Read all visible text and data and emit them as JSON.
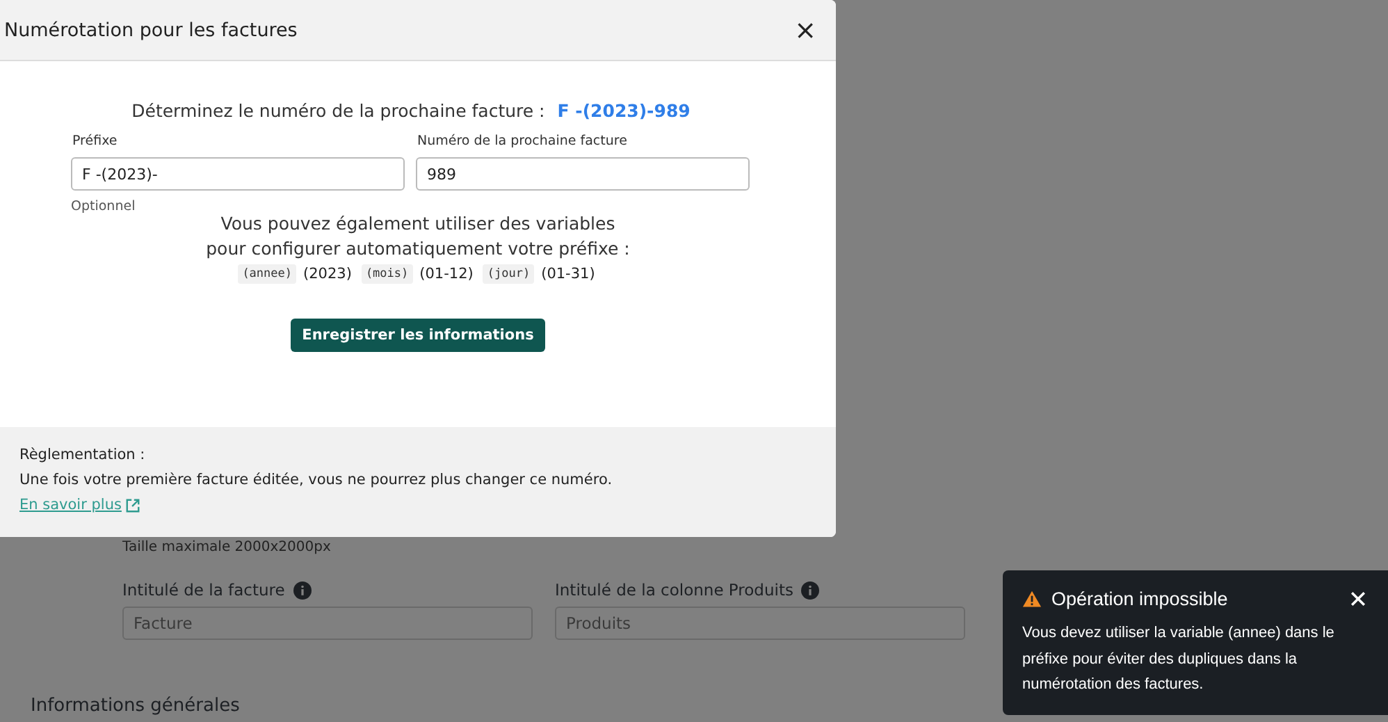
{
  "background": {
    "size_hint": "Taille maximale 2000x2000px",
    "fields": [
      {
        "label": "Intitulé de la facture",
        "placeholder": "Facture"
      },
      {
        "label": "Intitulé de la colonne Produits",
        "placeholder": "Produits"
      }
    ],
    "section_title": "Informations générales"
  },
  "modal": {
    "title": "Numérotation pour les factures",
    "close": "×",
    "heading": "Déterminez le numéro de la prochaine facture :",
    "preview": "F -(2023)-989",
    "fields": [
      {
        "label": "Préfixe",
        "value": "F -(2023)-",
        "help": "Optionnel"
      },
      {
        "label": "Numéro de la prochaine facture",
        "value": "989"
      }
    ],
    "variables_text": [
      "Vous pouvez également utiliser des variables",
      "pour configurer automatiquement votre préfixe :"
    ],
    "variables": [
      {
        "code": "(annee)",
        "range": "(2023)"
      },
      {
        "code": "(mois)",
        "range": "(01-12)"
      },
      {
        "code": "(jour)",
        "range": "(01-31)"
      }
    ],
    "save_button": "Enregistrer les informations",
    "footer": {
      "title": "Règlementation :",
      "text": "Une fois votre première facture éditée, vous ne pourrez plus changer ce numéro.",
      "link": "En savoir plus"
    }
  },
  "toast": {
    "title": "Opération impossible",
    "message": "Vous devez utiliser la variable (annee) dans le préfixe pour éviter des dupliques dans la numérotation des factures."
  }
}
